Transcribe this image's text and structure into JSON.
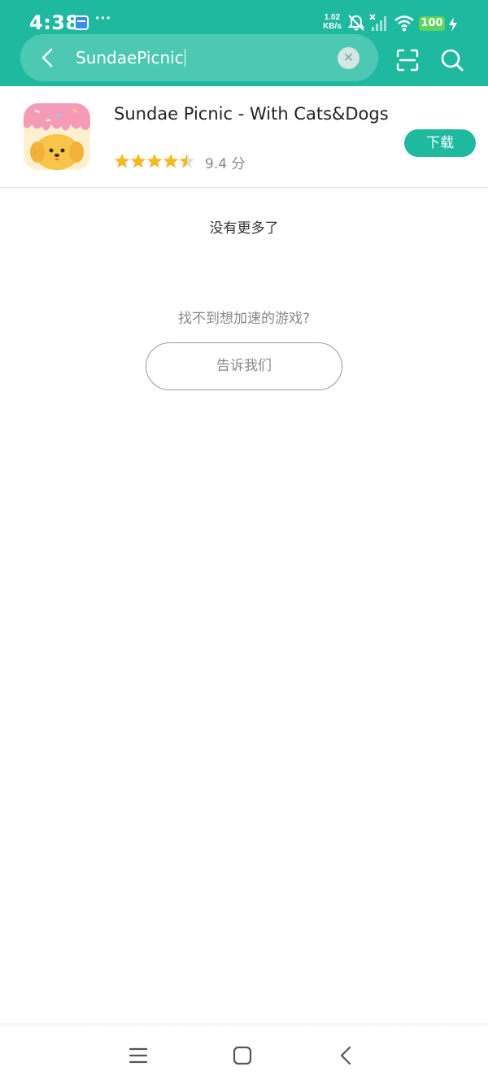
{
  "status_bar": {
    "time": "4:38",
    "more": "···",
    "net_speed_value": "1.02",
    "net_speed_unit": "KB/s",
    "battery": "100"
  },
  "search": {
    "query": "SundaePicnic"
  },
  "results": [
    {
      "title": "Sundae Picnic - With Cats&Dogs",
      "rating": 4.5,
      "rating_text": "9.4 分",
      "action_label": "下载"
    }
  ],
  "footer_text": {
    "no_more": "没有更多了",
    "not_found": "找不到想加速的游戏?",
    "tell_us_label": "告诉我们"
  },
  "colors": {
    "brand": "#1fb9a0",
    "star": "#f5b81f"
  },
  "icons": {
    "back": "back-icon",
    "clear": "clear-icon",
    "scan": "scan-icon",
    "search": "search-icon",
    "menu": "menu-icon",
    "home": "home-icon",
    "nav_back": "nav-back-icon"
  }
}
